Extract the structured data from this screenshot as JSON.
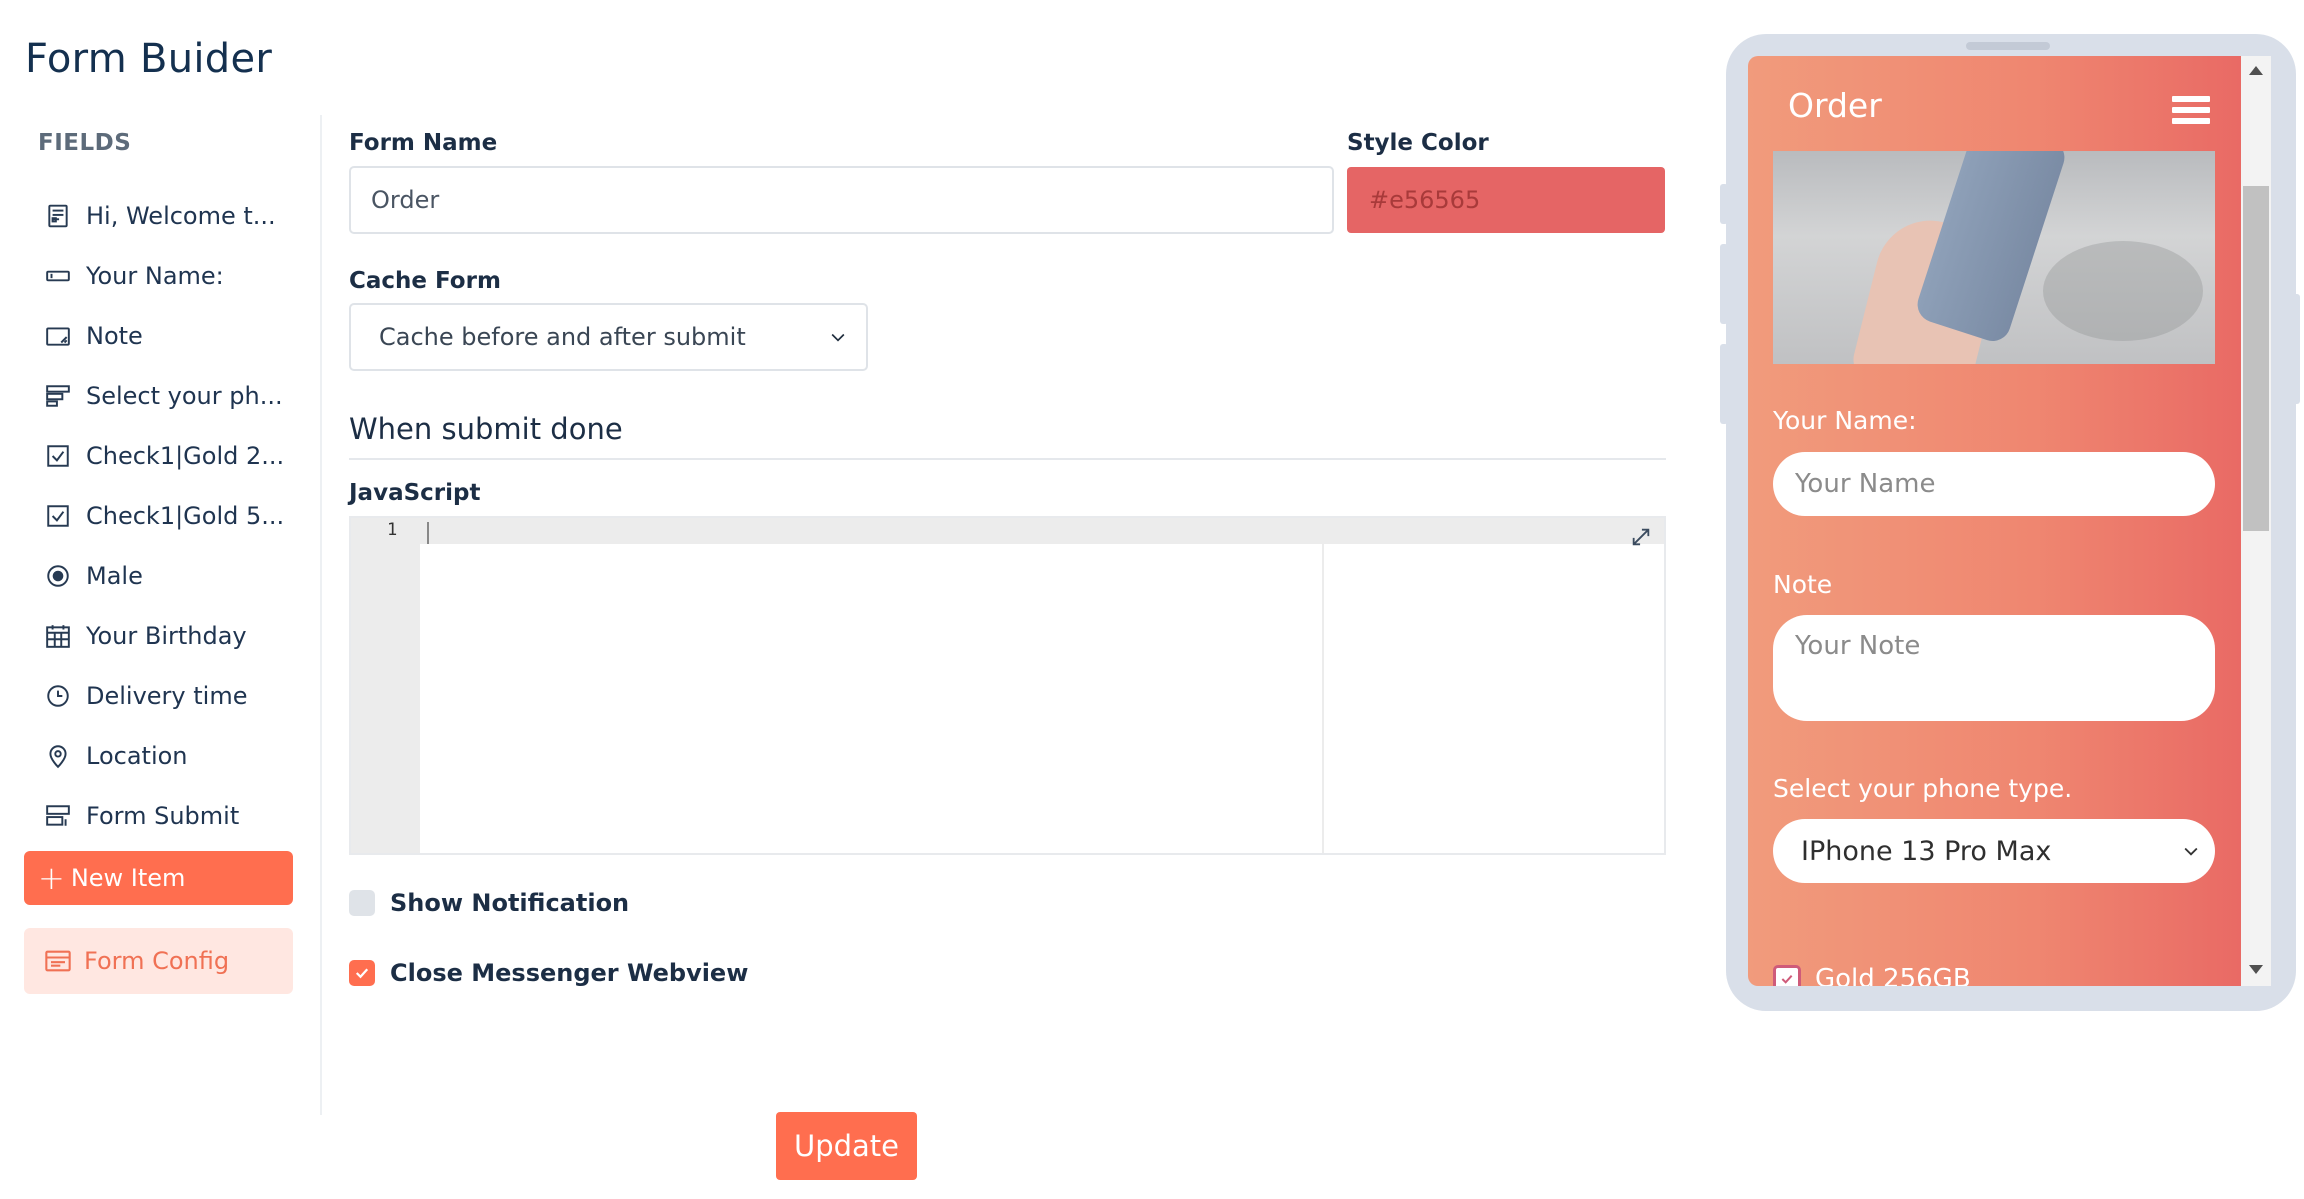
{
  "page": {
    "title": "Form Buider"
  },
  "sidebar": {
    "heading": "FIELDS",
    "items": [
      {
        "label": "Hi, Welcome t...",
        "icon": "text-block-icon"
      },
      {
        "label": "Your Name:",
        "icon": "text-input-icon"
      },
      {
        "label": "Note",
        "icon": "textarea-icon"
      },
      {
        "label": "Select your ph...",
        "icon": "select-list-icon"
      },
      {
        "label": "Check1|Gold 2...",
        "icon": "checkbox-icon"
      },
      {
        "label": "Check1|Gold 5...",
        "icon": "checkbox-icon"
      },
      {
        "label": "Male",
        "icon": "radio-icon"
      },
      {
        "label": "Your Birthday",
        "icon": "calendar-icon"
      },
      {
        "label": "Delivery time",
        "icon": "clock-icon"
      },
      {
        "label": "Location",
        "icon": "location-pin-icon"
      },
      {
        "label": "Form Submit",
        "icon": "form-submit-icon"
      }
    ],
    "new_item_label": "New Item",
    "form_config_label": "Form Config"
  },
  "form": {
    "name_label": "Form Name",
    "name_value": "Order",
    "style_color_label": "Style Color",
    "style_color_value": "#e56565",
    "cache_label": "Cache Form",
    "cache_value": "Cache before and after submit",
    "submit_section_title": "When submit done",
    "js_label": "JavaScript",
    "js_line_number": "1",
    "show_notification_label": "Show Notification",
    "show_notification_checked": false,
    "close_webview_label": "Close Messenger Webview",
    "close_webview_checked": true,
    "update_label": "Update"
  },
  "preview": {
    "title": "Order",
    "name_label": "Your Name:",
    "name_placeholder": "Your Name",
    "note_label": "Note",
    "note_placeholder": "Your Note",
    "phone_type_label": "Select your phone type.",
    "phone_type_value": "IPhone 13 Pro Max",
    "checkbox_label": "Gold 256GB",
    "checkbox_checked": true
  },
  "colors": {
    "accent": "#ff6e4f",
    "style_color": "#e56565",
    "title": "#14304f"
  }
}
